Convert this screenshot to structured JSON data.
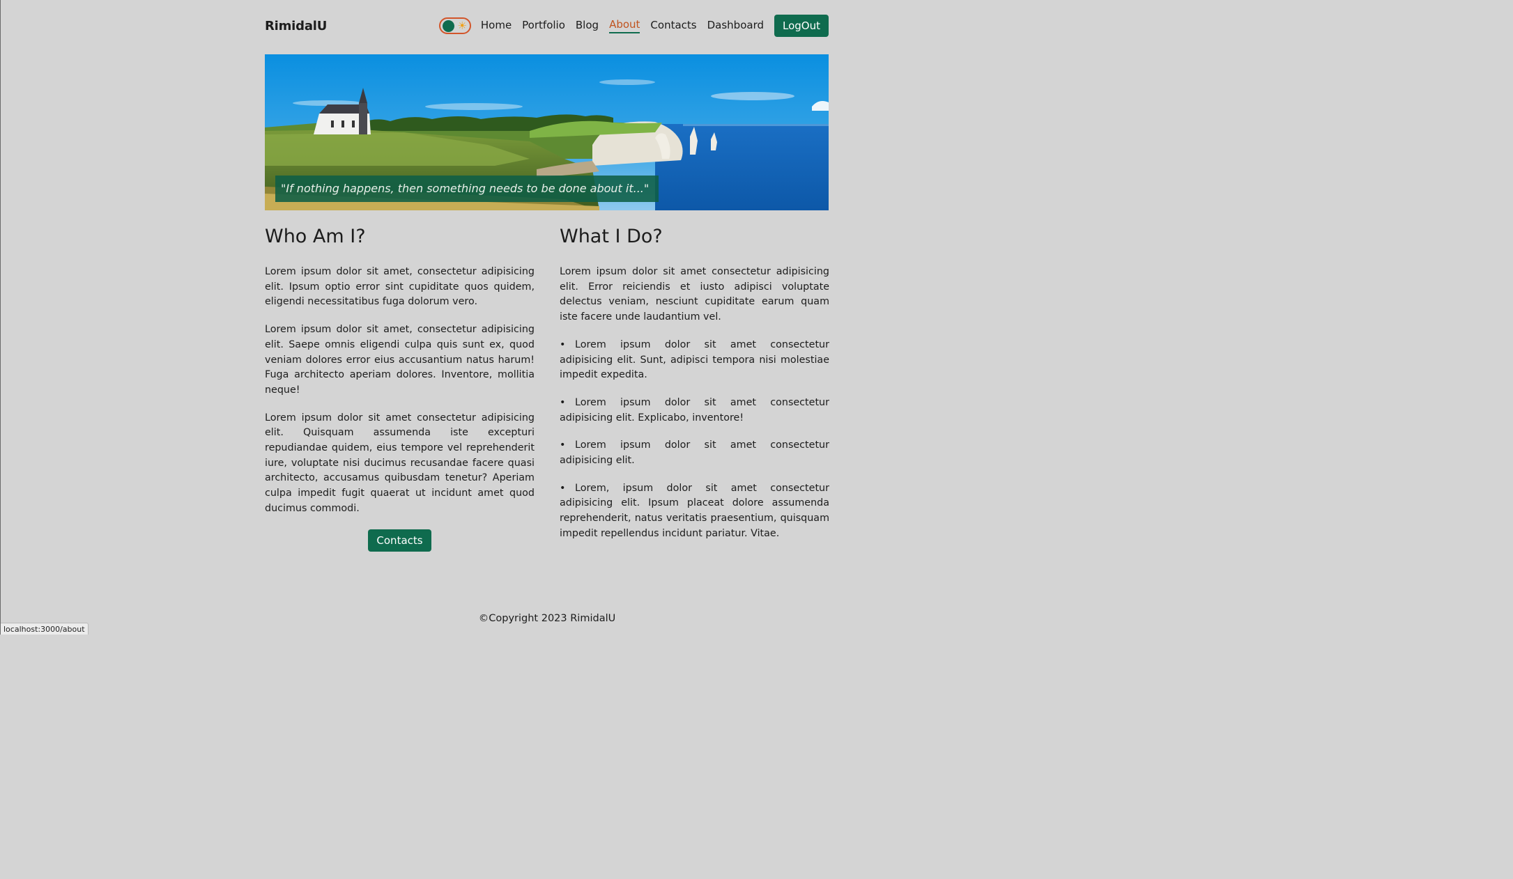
{
  "navbar": {
    "brand": "RimidalU",
    "toggle_sun_glyph": "☀",
    "links": [
      {
        "label": "Home"
      },
      {
        "label": "Portfolio"
      },
      {
        "label": "Blog"
      },
      {
        "label": "About",
        "active": true
      },
      {
        "label": "Contacts"
      },
      {
        "label": "Dashboard"
      }
    ],
    "logout_label": "LogOut"
  },
  "hero": {
    "quote": "\"If nothing happens, then something needs to be done about it...\"",
    "image_icon": "landscape-photo-cliffs-sea"
  },
  "who": {
    "title": "Who Am I?",
    "paragraphs": [
      "Lorem ipsum dolor sit amet, consectetur adipisicing elit. Ipsum optio error sint cupiditate quos quidem, eligendi necessitatibus fuga dolorum vero.",
      "Lorem ipsum dolor sit amet, consectetur adipisicing elit. Saepe omnis eligendi culpa quis sunt ex, quod veniam dolores error eius accusantium natus harum! Fuga architecto aperiam dolores. Inventore, mollitia neque!",
      "Lorem ipsum dolor sit amet consectetur adipisicing elit. Quisquam assumenda iste excepturi repudiandae quidem, eius tempore vel reprehenderit iure, voluptate nisi ducimus recusandae facere quasi architecto, accusamus quibusdam tenetur? Aperiam culpa impedit fugit quaerat ut incidunt amet quod ducimus commodi."
    ],
    "contacts_button": "Contacts"
  },
  "what": {
    "title": "What I Do?",
    "intro": "Lorem ipsum dolor sit amet consectetur adipisicing elit. Error reiciendis et iusto adipisci voluptate delectus veniam, nesciunt cupiditate earum quam iste facere unde laudantium vel.",
    "items": [
      "Lorem ipsum dolor sit amet consectetur adipisicing elit. Sunt, adipisci tempora nisi molestiae impedit expedita.",
      "Lorem ipsum dolor sit amet consectetur adipisicing elit. Explicabo, inventore!",
      "Lorem ipsum dolor sit amet consectetur adipisicing elit.",
      "Lorem, ipsum dolor sit amet consectetur adipisicing elit. Ipsum placeat dolore assumenda reprehenderit, natus veritatis praesentium, quisquam impedit repellendus incidunt pariatur. Vitae."
    ],
    "bullet_glyph": "•"
  },
  "footer": {
    "copyright": "©Copyright 2023 RimidalU"
  },
  "status_bar": {
    "url": "localhost:3000/about"
  },
  "colors": {
    "background": "#d4d4d4",
    "accent_green": "#0f6b4e",
    "active_link": "#c0531f",
    "toggle_border": "#d2552a",
    "sun": "#f0a11a"
  }
}
